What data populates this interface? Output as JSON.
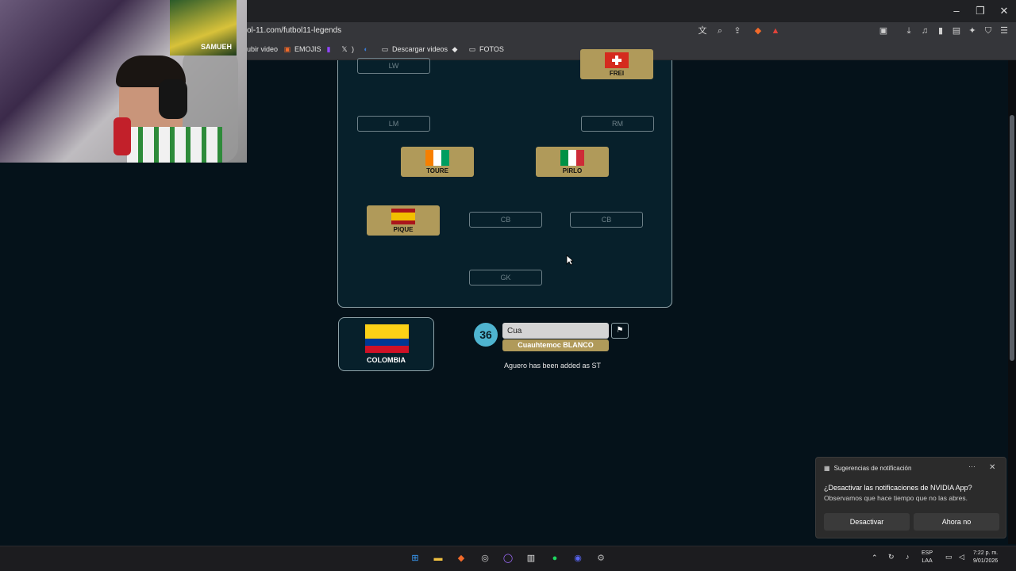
{
  "browser": {
    "url": "ol-11.com/futbol11-legends",
    "window_controls": [
      "–",
      "❐",
      "✕"
    ],
    "bookmarks": [
      {
        "label": "ubir video",
        "icon": "video-icon"
      },
      {
        "label": "EMOJIS",
        "icon": "emoji-icon"
      },
      {
        "label": "",
        "icon": "twitch-icon"
      },
      {
        "label": ")",
        "icon": "x-icon"
      },
      {
        "label": "",
        "icon": "edge-icon"
      },
      {
        "label": "Descargar videos",
        "icon": "folder-icon"
      },
      {
        "label": "",
        "icon": "diamond-icon"
      },
      {
        "label": "FOTOS",
        "icon": "folder-icon"
      }
    ]
  },
  "webcam": {
    "poster_text": "SAMUEH"
  },
  "lineup": {
    "empty_slots": {
      "lw": "LW",
      "lm": "LM",
      "rm": "RM",
      "cb1": "CB",
      "cb2": "CB",
      "gk": "GK"
    },
    "players": [
      {
        "name": "FREI",
        "flag": "switzerland"
      },
      {
        "name": "TOURE",
        "flag": "ivory-coast"
      },
      {
        "name": "PIRLO",
        "flag": "italy"
      },
      {
        "name": "PIQUE",
        "flag": "spain"
      }
    ]
  },
  "country": {
    "name": "COLOMBIA"
  },
  "guess": {
    "remaining": "36",
    "input_value": "Cua",
    "suggestion": "Cuauhtemoc BLANCO",
    "status": "Aguero has been added as ST"
  },
  "notification": {
    "header": "Sugerencias de notificación",
    "title": "¿Desactivar las notificaciones de NVIDIA App?",
    "body": "Observamos que hace tiempo que no las abres.",
    "btn_disable": "Desactivar",
    "btn_later": "Ahora no"
  },
  "taskbar": {
    "lang": "ESP",
    "layout": "LAA",
    "time": "7:22 p. m.",
    "date": "9/01/2026"
  },
  "colors": {
    "pitch_bg": "#07202b",
    "player_card": "#b09a5a",
    "counter": "#4fb4d0"
  }
}
